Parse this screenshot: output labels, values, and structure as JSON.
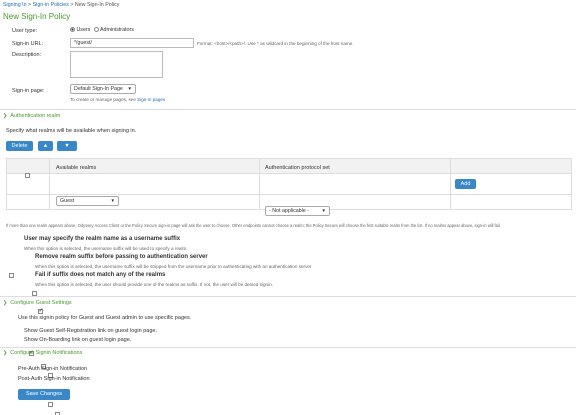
{
  "breadcrumb": {
    "items": [
      "Signing In",
      "Sign-in Policies"
    ],
    "separator": ">",
    "current": "New Sign-In Policy"
  },
  "page_title": "New Sign-In Policy",
  "form": {
    "user_type_label": "User type:",
    "user_type_options": [
      "Users",
      "Administrators"
    ],
    "user_type_selected": "Users",
    "signin_url_label": "Sign-in URL:",
    "signin_url_value": "*/guest/",
    "signin_url_hint": "Format: <host>/<path>/. Use * as wildcard in the beginning of the host name.",
    "description_label": "Description:",
    "description_value": "",
    "signin_page_label": "Sign-in page:",
    "signin_page_value": "Default Sign-In Page",
    "signin_page_hint_prefix": "To create or manage pages, see",
    "signin_page_hint_link": "Sign-in pages"
  },
  "auth_realms": {
    "section_title": "Authentication realm",
    "intro": "Specify what realms will be available when signing in.",
    "delete_label": "Delete",
    "columns": [
      "Available realms",
      "Authentication protocol set"
    ],
    "realm_value": "Guest",
    "protocol_value": "- Not applicable -",
    "add_label": "Add",
    "note": "If more than one realm appears above, Odyssey Access Client or the Policy Secure sign-in page will ask the user to choose. Other endpoints cannot choose a realm; the Policy Secure will choose the first suitable realm from the list. If no realms appear above, sign-in will fail.",
    "suffix_title": "User may specify the realm name as a username suffix",
    "suffix_hint": "When this option is selected, the username suffix will be used to specify a realm.",
    "remove_suffix_title": "Remove realm suffix before passing to authentication server",
    "remove_suffix_hint": "When this option is selected, the username suffix will be stripped from the username prior to authenticating with an authentication server",
    "fail_title": "Fail if suffix does not match any of the realms",
    "fail_hint": "When this option is selected, the user should provide one of the realms as suffix. If not, the user will be denied signin."
  },
  "guest_settings": {
    "section_title": "Configure Guest Settings",
    "use_policy_label": "Use this signin policy for Guest and Guest admin to use specific pages.",
    "self_reg_label": "Show Guest Self-Registration link on guest login page.",
    "onboarding_label": "Show On-Boarding link on guest login page."
  },
  "signin_notifications": {
    "section_title": "Configure Signin Notifications",
    "pre_auth_label": "Pre-Auth Sign-in Notification",
    "post_auth_label": "Post-Auth Sign-in Notification"
  },
  "save_label": "Save Changes"
}
